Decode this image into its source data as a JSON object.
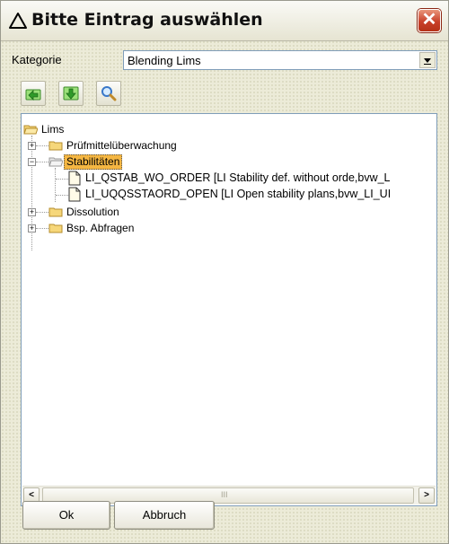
{
  "window": {
    "title": "Bitte Eintrag auswählen",
    "close_label": "✕"
  },
  "category": {
    "label": "Kategorie",
    "value": "Blending Lims"
  },
  "toolbar": {
    "icons": [
      "collapse-icon",
      "expand-icon",
      "search-icon"
    ]
  },
  "tree": {
    "root": "Lims",
    "items": [
      {
        "label": "Prüfmittelüberwachung",
        "expanded": false
      },
      {
        "label": "Stabilitäten",
        "expanded": true,
        "selected": true,
        "children": [
          "LI_QSTAB_WO_ORDER [LI Stability def. without orde,bvw_L",
          "LI_UQQSSTAORD_OPEN [LI Open stability plans,bvw_LI_UI"
        ]
      },
      {
        "label": "Dissolution",
        "expanded": false
      },
      {
        "label": "Bsp. Abfragen",
        "expanded": false
      }
    ]
  },
  "scrollbar": {
    "left": "<",
    "right": ">",
    "grip": "III"
  },
  "buttons": {
    "ok": "Ok",
    "cancel": "Abbruch"
  }
}
